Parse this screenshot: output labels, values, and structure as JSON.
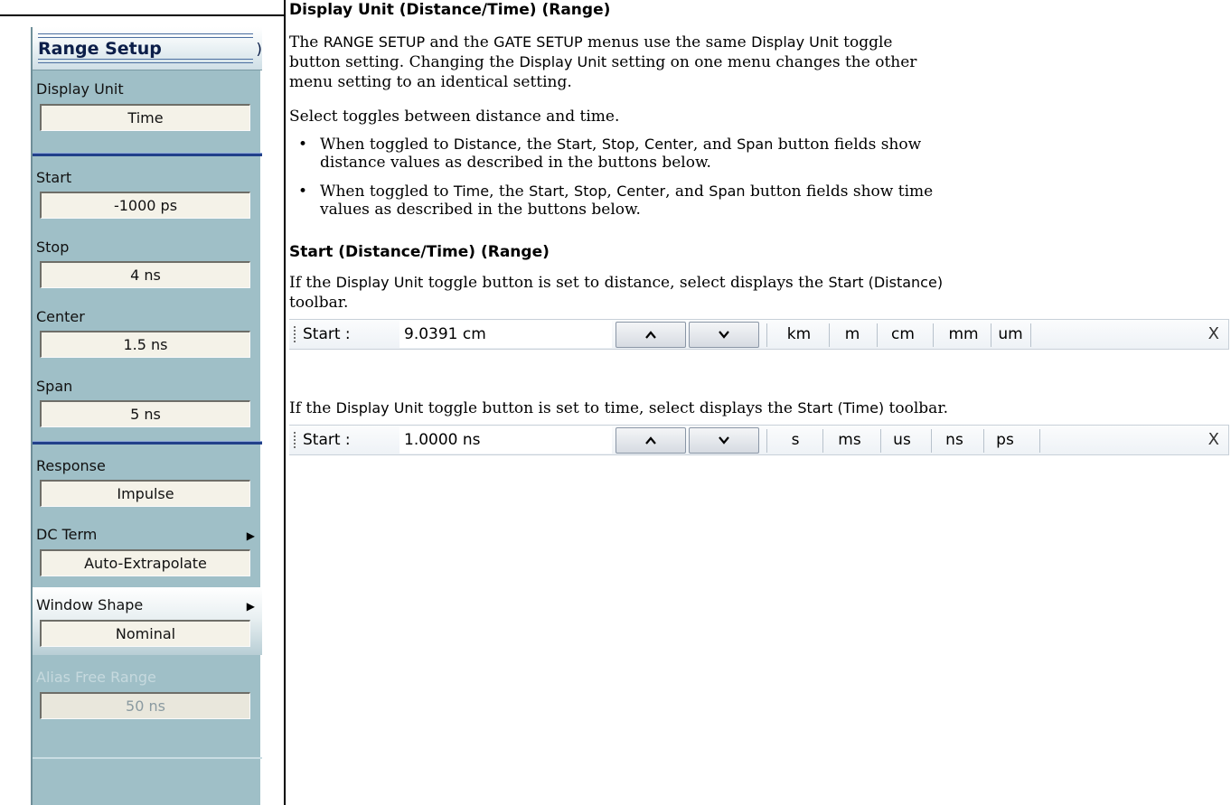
{
  "menu": {
    "title": "Range Setup",
    "close_glyph": ")",
    "buttons": [
      {
        "label": "Display Unit",
        "value": "Time"
      },
      {
        "label": "Start",
        "value": "-1000 ps"
      },
      {
        "label": "Stop",
        "value": "4 ns"
      },
      {
        "label": "Center",
        "value": "1.5 ns"
      },
      {
        "label": "Span",
        "value": "5 ns"
      },
      {
        "label": "Response",
        "value": "Impulse"
      },
      {
        "label": "DC Term",
        "value": "Auto-Extrapolate",
        "submenu": true
      },
      {
        "label": "Window Shape",
        "value": "Nominal",
        "submenu": true
      },
      {
        "label": "Alias Free Range",
        "value": "50 ns",
        "disabled": true
      }
    ]
  },
  "section1": {
    "heading": "Display Unit (Distance/Time) (Range)",
    "para1": {
      "t1": "The ",
      "s1": "RANGE SETUP",
      "t2": " and the ",
      "s2": "GATE SETUP",
      "t3": " menus use the same ",
      "s3": "Display Unit",
      "t4": " toggle",
      "line2a": "button setting. Changing the ",
      "s4": "Display Unit",
      "line2b": " setting on one menu changes the other",
      "line3": "menu setting to an identical setting."
    },
    "para2": "Select toggles between distance and time.",
    "bullets": [
      {
        "l1a": "When toggled to ",
        "u": "Distance",
        "l1b": ", the ",
        "a": "Start",
        "c1": ", ",
        "b": "Stop",
        "c2": ", ",
        "c": "Center",
        "c3": ", and ",
        "d": "Span",
        "l1c": " button fields show",
        "l2": "distance values as described in the buttons below."
      },
      {
        "l1a": "When toggled to ",
        "u": "Time",
        "l1b": ", the ",
        "a": "Start",
        "c1": ", ",
        "b": "Stop",
        "c2": ", ",
        "c": "Center",
        "c3": ", and ",
        "d": "Span",
        "l1c": " button fields show time",
        "l2": "values as described in the buttons below."
      }
    ]
  },
  "section2": {
    "heading": "Start (Distance/Time) (Range)",
    "para1": {
      "t1": "If the ",
      "s1": "Display Unit",
      "t2": " toggle button is set to distance, select displays the ",
      "s2": "Start (Distance)",
      "line2": "toolbar."
    },
    "para2": {
      "t1": "If the ",
      "s1": "Display Unit",
      "t2": " toggle button is set to time, select displays the ",
      "s2": "Start (Time)",
      "t3": " toolbar."
    }
  },
  "toolbar_distance": {
    "label": "Start :",
    "value": "9.0391 cm",
    "units": [
      "km",
      "m",
      "cm",
      "mm",
      "um"
    ],
    "close": "X"
  },
  "toolbar_time": {
    "label": "Start :",
    "value": "1.0000 ns",
    "units": [
      "s",
      "ms",
      "us",
      "ns",
      "ps"
    ],
    "close": "X"
  }
}
